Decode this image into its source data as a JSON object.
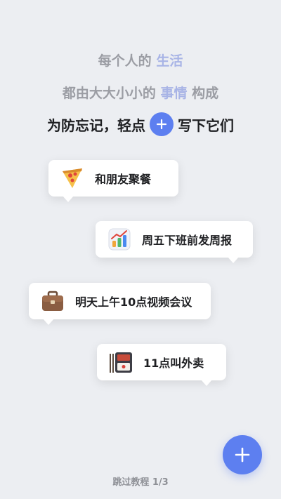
{
  "intro": {
    "line1_prefix": "每个人的",
    "line1_highlight": "生活",
    "line2_prefix": "都由大大小小的",
    "line2_highlight": "事情",
    "line2_suffix": "构成",
    "line3_prefix": "为防忘记，轻点",
    "line3_suffix": "写下它们"
  },
  "cards": [
    {
      "icon": "pizza-icon",
      "label": "和朋友聚餐"
    },
    {
      "icon": "chart-icon",
      "label": "周五下班前发周报"
    },
    {
      "icon": "briefcase-icon",
      "label": "明天上午10点视频会议"
    },
    {
      "icon": "bento-box-icon",
      "label": "11点叫外卖"
    }
  ],
  "fab": {
    "icon": "plus-icon"
  },
  "footer": {
    "skip_label": "跳过教程 1/3"
  },
  "colors": {
    "accent": "#5d7ff0",
    "highlight": "#a8b4e6",
    "background": "#eceef2"
  }
}
